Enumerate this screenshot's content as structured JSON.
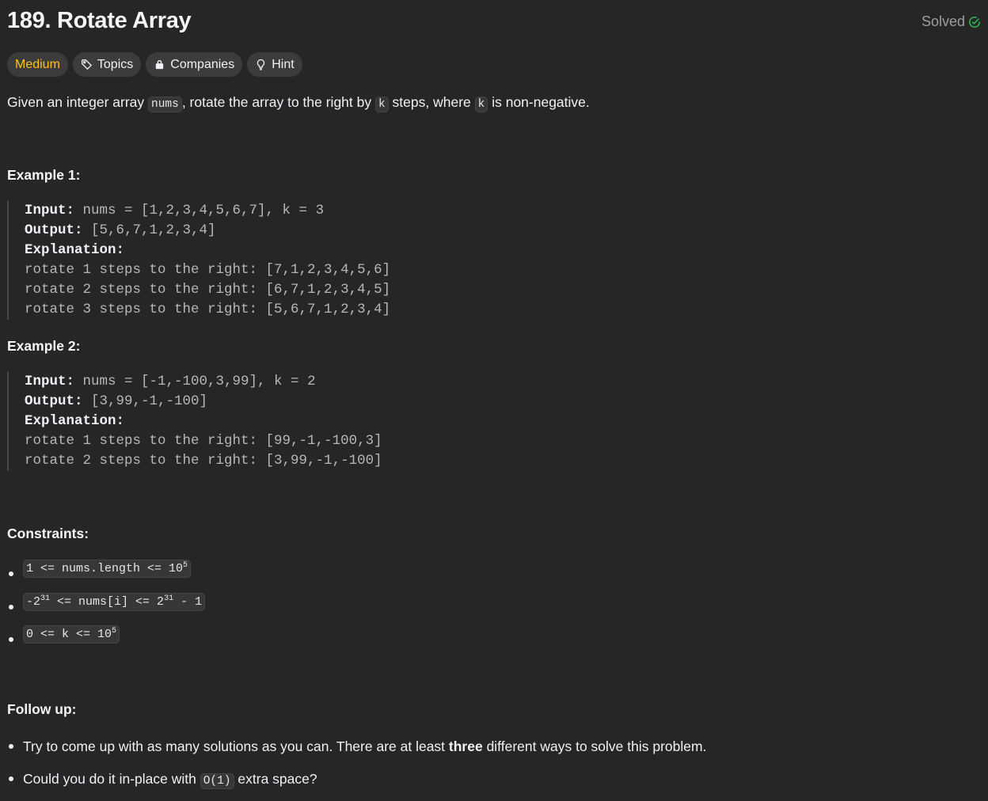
{
  "header": {
    "title": "189. Rotate Array",
    "status": "Solved",
    "accent_green": "#2cbb5d"
  },
  "tags": {
    "difficulty": "Medium",
    "difficulty_color": "#ffc01e",
    "topics": "Topics",
    "companies": "Companies",
    "hint": "Hint"
  },
  "description": {
    "p1": "Given an integer array ",
    "code_nums": "nums",
    "p2": ", rotate the array to the right by ",
    "code_k1": "k",
    "p3": " steps, where ",
    "code_k2": "k",
    "p4": " is non-negative."
  },
  "examples": [
    {
      "heading": "Example 1:",
      "input_label": "Input:",
      "input": " nums = [1,2,3,4,5,6,7], k = 3",
      "output_label": "Output:",
      "output": " [5,6,7,1,2,3,4]",
      "explanation_label": "Explanation:",
      "lines": [
        "rotate 1 steps to the right: [7,1,2,3,4,5,6]",
        "rotate 2 steps to the right: [6,7,1,2,3,4,5]",
        "rotate 3 steps to the right: [5,6,7,1,2,3,4]"
      ]
    },
    {
      "heading": "Example 2:",
      "input_label": "Input:",
      "input": " nums = [-1,-100,3,99], k = 2",
      "output_label": "Output:",
      "output": " [3,99,-1,-100]",
      "explanation_label": "Explanation:",
      "lines": [
        "rotate 1 steps to the right: [99,-1,-100,3]",
        "rotate 2 steps to the right: [3,99,-1,-100]"
      ]
    }
  ],
  "constraints": {
    "heading": "Constraints:",
    "c1_a": "1 <= nums.length <= 10",
    "c1_sup": "5",
    "c2_a": "-2",
    "c2_sup1": "31",
    "c2_b": " <= nums[i] <= 2",
    "c2_sup2": "31",
    "c2_c": " - 1",
    "c3_a": "0 <= k <= 10",
    "c3_sup": "5"
  },
  "follow_up": {
    "heading": "Follow up:",
    "f1_a": "Try to come up with as many solutions as you can. There are at least ",
    "f1_bold": "three",
    "f1_b": " different ways to solve this problem.",
    "f2_a": "Could you do it in-place with ",
    "f2_code": "O(1)",
    "f2_b": " extra space?"
  }
}
